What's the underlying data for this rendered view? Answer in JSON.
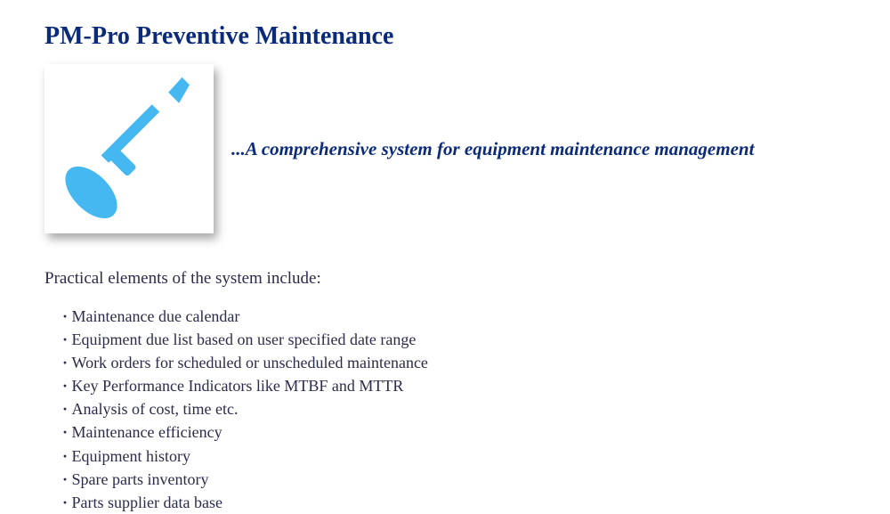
{
  "title": "PM-Pro Preventive Maintenance",
  "tagline": "...A comprehensive  system for equipment maintenance management",
  "intro": "Practical elements of the system include:",
  "features": [
    "Maintenance due calendar",
    "Equipment due list based on user specified date range",
    "Work orders for scheduled or unscheduled maintenance",
    "Key Performance Indicators like MTBF and MTTR",
    "Analysis of cost, time etc.",
    "Maintenance efficiency",
    "Equipment history",
    "Spare parts inventory",
    "Parts supplier data base"
  ],
  "colors": {
    "accent": "#0b2b7a",
    "icon": "#45b8f2",
    "text": "#2b2b4b"
  }
}
